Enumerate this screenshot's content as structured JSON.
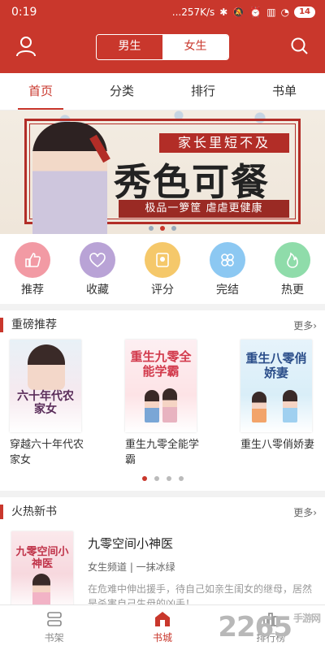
{
  "status_bar": {
    "time": "0:19",
    "network_speed": "...257K/s",
    "battery": "14"
  },
  "header": {
    "gender_male": "男生",
    "gender_female": "女生",
    "selected_gender": "女生"
  },
  "tabs": [
    {
      "label": "首页",
      "active": true
    },
    {
      "label": "分类",
      "active": false
    },
    {
      "label": "排行",
      "active": false
    },
    {
      "label": "书单",
      "active": false
    }
  ],
  "banner": {
    "tagline": "家长里短不及",
    "title": "秀色可餐",
    "slogan": "极品一箩筐 虐虐更健康"
  },
  "categories": [
    {
      "label": "推荐",
      "icon": "thumbs-up-icon",
      "color": "#f29aa4"
    },
    {
      "label": "收藏",
      "icon": "heart-icon",
      "color": "#b9a3d6"
    },
    {
      "label": "评分",
      "icon": "badge-icon",
      "color": "#f5c86a"
    },
    {
      "label": "完结",
      "icon": "clover-icon",
      "color": "#8cc8f2"
    },
    {
      "label": "热更",
      "icon": "flame-icon",
      "color": "#8fdcaa"
    }
  ],
  "featured": {
    "title": "重磅推荐",
    "more": "更多›",
    "books": [
      {
        "name": "穿越六十年代农家女",
        "cover_text": "六十年代农家女"
      },
      {
        "name": "重生九零全能学霸",
        "cover_text": "重生九零全能学霸"
      },
      {
        "name": "重生八零俏娇妻",
        "cover_text": "重生八零俏娇妻"
      }
    ]
  },
  "new_books": {
    "title": "火热新书",
    "more": "更多›",
    "items": [
      {
        "title": "九零空间小神医",
        "channel": "女生频道",
        "author": "一抹冰绿",
        "meta": "女生频道 | 一抹冰绿",
        "desc": "在危难中伸出援手，待自己如亲生闺女的继母，居然是杀害自己生母的凶手！...",
        "cover_text": "九零空间小神医"
      }
    ]
  },
  "bottom_nav": [
    {
      "label": "书架",
      "active": false
    },
    {
      "label": "书城",
      "active": true
    },
    {
      "label": "排行榜",
      "active": false
    }
  ],
  "watermark": {
    "text": "2265",
    "suffix": "手游网",
    "url": ".com"
  },
  "colors": {
    "brand": "#c9372c"
  }
}
